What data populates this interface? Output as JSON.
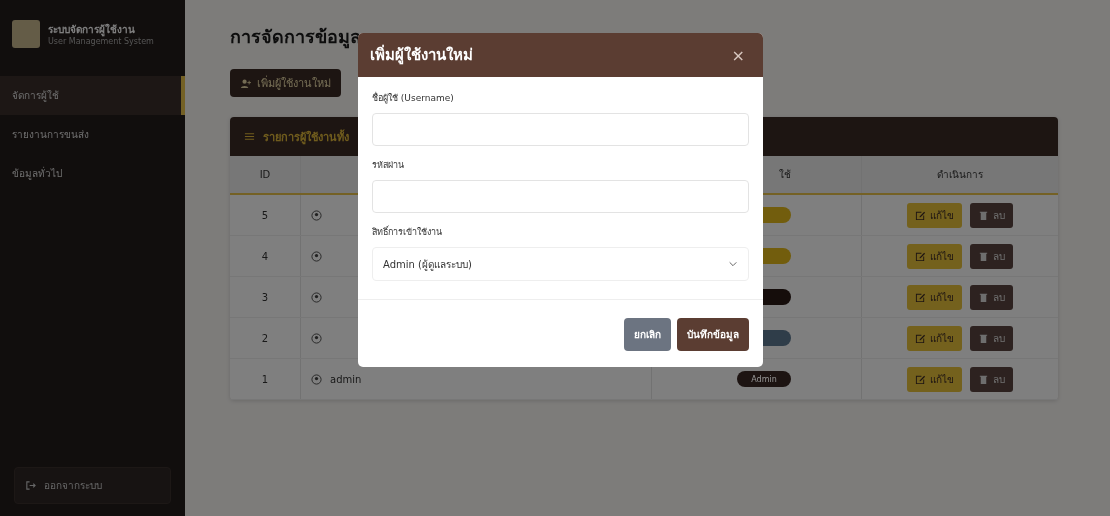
{
  "sidebar": {
    "brand": {
      "title": "ระบบจัดการผู้ใช้งาน",
      "subtitle": "User Management System"
    },
    "items": [
      {
        "label": "จัดการผู้ใช้",
        "selected": true
      },
      {
        "label": "รายงานการขนส่ง",
        "selected": false
      },
      {
        "label": "ข้อมูลทั่วไป",
        "selected": false
      }
    ],
    "logout": "ออกจากระบบ"
  },
  "page": {
    "title": "การจัดการข้อมูล",
    "add_button": "เพิ่มผู้ใช้งานใหม่"
  },
  "table": {
    "title": "รายการผู้ใช้งานทั้ง",
    "columns": [
      "ID",
      "",
      "ใช้",
      "ดำเนินการ"
    ],
    "rows": [
      {
        "id": "5",
        "role": {
          "color": "#725d0d"
        },
        "edit_label": "แก้ไข",
        "delete_label": "ลบ"
      },
      {
        "id": "4",
        "role": {
          "color": "#725d0d"
        },
        "edit_label": "แก้ไข",
        "delete_label": "ลบ"
      },
      {
        "id": "3",
        "role": {
          "color": "#150d0b"
        },
        "edit_label": "แก้ไข",
        "delete_label": "ลบ"
      },
      {
        "id": "2",
        "role": {
          "color": "#2f3d49"
        },
        "edit_label": "แก้ไข",
        "delete_label": "ลบ"
      },
      {
        "id": "1",
        "username": "admin",
        "role": {
          "color": "#1d1412",
          "label": "Admin"
        },
        "edit_label": "แก้ไข",
        "delete_label": "ลบ"
      }
    ]
  },
  "modal": {
    "title": "เพิ่มผู้ใช้งานใหม่",
    "close": "×",
    "fields": [
      {
        "kind": "text",
        "label": "ชื่อผู้ใช้ (Username)"
      },
      {
        "kind": "password",
        "label": "รหัสผ่าน"
      },
      {
        "kind": "select",
        "label": "สิทธิ์การเข้าใช้งาน",
        "value": "Admin (ผู้ดูแลระบบ)"
      }
    ],
    "buttons": [
      {
        "label": "ยกเลิก",
        "kind": "cancel"
      },
      {
        "label": "บันทึกข้อมูล",
        "kind": "save"
      }
    ]
  }
}
